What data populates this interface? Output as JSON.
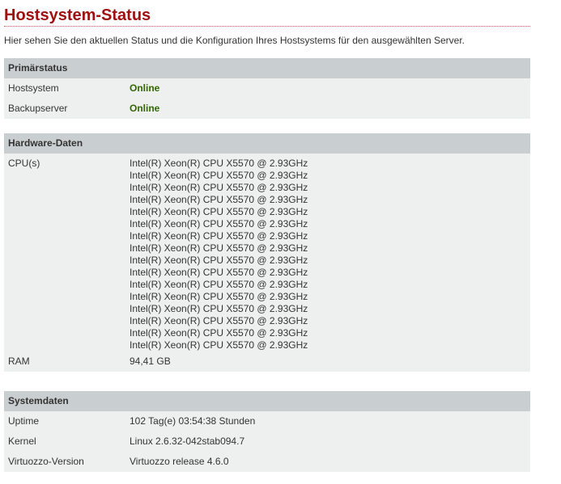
{
  "page": {
    "title": "Hostsystem-Status",
    "intro": "Hier sehen Sie den aktuellen Status und die Konfiguration Ihres Hostsystems für den ausgewählten Server."
  },
  "primary_status": {
    "header": "Primärstatus",
    "rows": [
      {
        "label": "Hostsystem",
        "value": "Online"
      },
      {
        "label": "Backupserver",
        "value": "Online"
      }
    ],
    "online_color": "#336600"
  },
  "hardware": {
    "header": "Hardware-Daten",
    "cpu_label": "CPU(s)",
    "cpus": [
      "Intel(R) Xeon(R) CPU X5570 @ 2.93GHz",
      "Intel(R) Xeon(R) CPU X5570 @ 2.93GHz",
      "Intel(R) Xeon(R) CPU X5570 @ 2.93GHz",
      "Intel(R) Xeon(R) CPU X5570 @ 2.93GHz",
      "Intel(R) Xeon(R) CPU X5570 @ 2.93GHz",
      "Intel(R) Xeon(R) CPU X5570 @ 2.93GHz",
      "Intel(R) Xeon(R) CPU X5570 @ 2.93GHz",
      "Intel(R) Xeon(R) CPU X5570 @ 2.93GHz",
      "Intel(R) Xeon(R) CPU X5570 @ 2.93GHz",
      "Intel(R) Xeon(R) CPU X5570 @ 2.93GHz",
      "Intel(R) Xeon(R) CPU X5570 @ 2.93GHz",
      "Intel(R) Xeon(R) CPU X5570 @ 2.93GHz",
      "Intel(R) Xeon(R) CPU X5570 @ 2.93GHz",
      "Intel(R) Xeon(R) CPU X5570 @ 2.93GHz",
      "Intel(R) Xeon(R) CPU X5570 @ 2.93GHz",
      "Intel(R) Xeon(R) CPU X5570 @ 2.93GHz"
    ],
    "ram_label": "RAM",
    "ram_value": "94,41 GB"
  },
  "system": {
    "header": "Systemdaten",
    "rows": [
      {
        "label": "Uptime",
        "value": "102 Tag(e) 03:54:38 Stunden"
      },
      {
        "label": "Kernel",
        "value": "Linux 2.6.32-042stab094.7"
      },
      {
        "label": "Virtuozzo-Version",
        "value": "Virtuozzo release 4.6.0"
      }
    ]
  },
  "colors": {
    "title": "#a01010",
    "section_header_bg": "#c9cfd0",
    "section_body_bg": "#eef0f0",
    "text": "#333333"
  }
}
